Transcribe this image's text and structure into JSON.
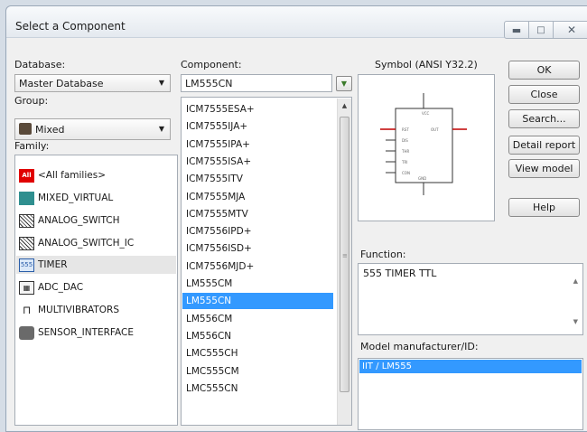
{
  "window": {
    "title": "Select a Component",
    "min_icon": "minimize-icon",
    "max_icon": "maximize-icon",
    "close_icon": "close-icon"
  },
  "database": {
    "label": "Database:",
    "value": "Master Database"
  },
  "group": {
    "label": "Group:",
    "value": "Mixed",
    "icon": "mixed-group-icon"
  },
  "family": {
    "label": "Family:",
    "items": [
      {
        "label": "<All families>",
        "icon": "all-families-icon"
      },
      {
        "label": "MIXED_VIRTUAL",
        "icon": "mixed-virtual-icon"
      },
      {
        "label": "ANALOG_SWITCH",
        "icon": "analog-switch-icon"
      },
      {
        "label": "ANALOG_SWITCH_IC",
        "icon": "analog-switch-ic-icon"
      },
      {
        "label": "TIMER",
        "icon": "timer-icon"
      },
      {
        "label": "ADC_DAC",
        "icon": "adc-dac-icon"
      },
      {
        "label": "MULTIVIBRATORS",
        "icon": "multivibrator-icon"
      },
      {
        "label": "SENSOR_INTERFACE",
        "icon": "sensor-interface-icon"
      }
    ],
    "selected_index": 4
  },
  "component": {
    "label": "Component:",
    "search_value": "LM555CN",
    "filter_icon": "filter-icon",
    "items": [
      "ICM7555ESA+",
      "ICM7555IJA+",
      "ICM7555IPA+",
      "ICM7555ISA+",
      "ICM7555ITV",
      "ICM7555MJA",
      "ICM7555MTV",
      "ICM7556IPD+",
      "ICM7556ISD+",
      "ICM7556MJD+",
      "LM555CM",
      "LM555CN",
      "LM556CM",
      "LM556CN",
      "LMC555CH",
      "LMC555CM",
      "LMC555CN"
    ],
    "selected_index": 11
  },
  "symbol": {
    "label": "Symbol (ANSI Y32.2)"
  },
  "function": {
    "label": "Function:",
    "text": "555 TIMER TTL"
  },
  "model": {
    "label": "Model manufacturer/ID:",
    "selected": "IIT / LM555"
  },
  "buttons": {
    "ok": "OK",
    "close": "Close",
    "search": "Search...",
    "detail_report": "Detail report",
    "view_model": "View model",
    "help": "Help"
  }
}
